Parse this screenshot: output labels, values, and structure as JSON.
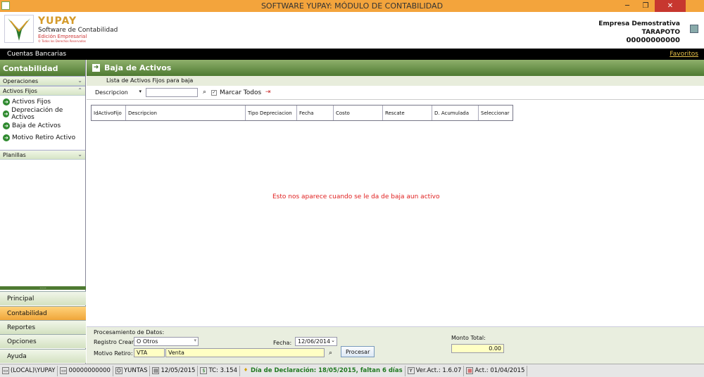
{
  "window": {
    "title": "SOFTWARE YUPAY: MÓDULO DE CONTABILIDAD"
  },
  "logo": {
    "name": "YUPAY",
    "subtitle": "Software de Contabilidad",
    "edition": "Edición Empresarial",
    "tiny": "© Todos los Derechos Reservados"
  },
  "company": {
    "name": "Empresa Demostrativa",
    "city": "TARAPOTO",
    "ruc": "00000000000"
  },
  "topbar": {
    "location": "Cuentas Bancarias",
    "favorites": "Favoritos"
  },
  "sidebar": {
    "title": "Contabilidad",
    "sections": {
      "operaciones": "Operaciones",
      "activos": "Activos Fijos",
      "planillas": "Planillas"
    },
    "items": [
      "Activos Fijos",
      "Depreciación de Activos",
      "Baja de Activos",
      "Motivo Retiro Activo"
    ],
    "grip": ".....",
    "nav": [
      "Principal",
      "Contabilidad",
      "Reportes",
      "Opciones",
      "Ayuda"
    ]
  },
  "main": {
    "title": "Baja de Activos",
    "subtitle": "Lista de Activos Fijos para baja",
    "toolbar": {
      "field": "Descripcion",
      "search_value": "",
      "mark_all": "Marcar Todos"
    },
    "columns": [
      "IdActivoFijo",
      "Descripcion",
      "Tipo Depreciacion",
      "Fecha",
      "Costo",
      "Rescate",
      "D. Acumulada",
      "Seleccionar"
    ],
    "message": "Esto nos aparece cuando se le da de baja aun activo"
  },
  "process": {
    "section": "Procesamiento de Datos:",
    "registro_label": "Registro Crear:",
    "registro_value": "O   Otros",
    "fecha_label": "Fecha:",
    "fecha_value": "12/06/2014",
    "motivo_label": "Motivo Retiro:",
    "motivo_code": "VTA",
    "motivo_desc": "Venta",
    "procesar": "Procesar",
    "monto_label": "Monto Total:",
    "monto_value": "0.00"
  },
  "status": {
    "server": "(LOCAL)\\YUPAY",
    "ruc": "00000000000",
    "user": "YUNTAS",
    "date": "12/05/2015",
    "tc": "TC: 3.154",
    "declaracion": "Día de Declaración: 18/05/2015, faltan 6 días",
    "version": "Ver.Act.: 1.6.07",
    "act": "Act.: 01/04/2015"
  }
}
